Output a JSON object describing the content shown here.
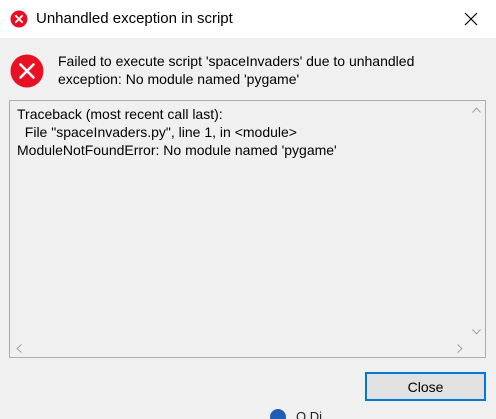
{
  "window": {
    "title": "Unhandled exception in script",
    "close_glyph": "✕",
    "icons": {
      "title": "error-icon",
      "message": "error-icon",
      "close": "close-icon"
    }
  },
  "message": {
    "line1": "Failed to execute script 'spaceInvaders' due to unhandled",
    "line2": "exception: No module named 'pygame'"
  },
  "traceback": {
    "lines": [
      "Traceback (most recent call last):",
      "  File \"spaceInvaders.py\", line 1, in <module>",
      "ModuleNotFoundError: No module named 'pygame'"
    ]
  },
  "buttons": {
    "close_label": "Close"
  },
  "background_peek": {
    "text": "O  Di"
  },
  "colors": {
    "error_red": "#e81123",
    "focus_blue": "#0078d7",
    "dialog_bg": "#f0f0f0",
    "titlebar_bg": "#ffffff"
  }
}
